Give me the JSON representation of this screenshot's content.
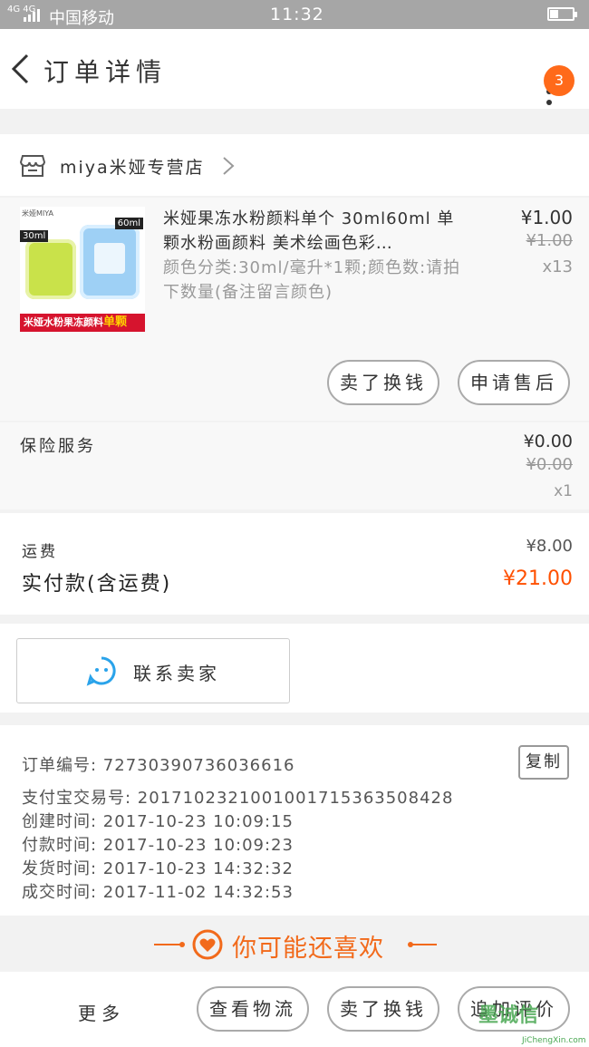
{
  "status_bar": {
    "network": "4G 4G",
    "carrier": "中国移动",
    "time": "11:32"
  },
  "header": {
    "title": "订单详情",
    "badge_count": "3"
  },
  "shop": {
    "name": "miya米娅专营店"
  },
  "product": {
    "title": "米娅果冻水粉颜料单个 30ml60ml 单颗水粉画颜料 美术绘画色彩…",
    "sku": "颜色分类:30ml/毫升*1颗;颜色数:请拍下数量(备注留言颜色)",
    "price": "¥1.00",
    "original_price": "¥1.00",
    "quantity": "x13",
    "thumb_brand": "米娅MIYA",
    "thumb_label_small": "30ml",
    "thumb_label_large": "60ml",
    "thumb_banner": "米娅水粉果冻颜料",
    "thumb_banner_tag": "单颗",
    "btn_return": "卖了换钱",
    "btn_aftersale": "申请售后"
  },
  "insurance": {
    "label": "保险服务",
    "price": "¥0.00",
    "original_price": "¥0.00",
    "quantity": "x1"
  },
  "freight": {
    "label": "运费",
    "value": "¥8.00",
    "total_label": "实付款(含运费)",
    "total_value": "¥21.00"
  },
  "contact": {
    "label": "联系卖家"
  },
  "order_info": {
    "copy_label": "复制",
    "lines": [
      "订单编号: 72730390736036616",
      "支付宝交易号: 2017102321001001715363508428",
      "创建时间: 2017-10-23 10:09:15",
      "付款时间: 2017-10-23 10:09:23",
      "发货时间: 2017-10-23 14:32:32",
      "成交时间: 2017-11-02 14:32:53"
    ]
  },
  "recommend": {
    "label": "你可能还喜欢"
  },
  "bottom_bar": {
    "more": "更多",
    "logistics": "查看物流",
    "sell": "卖了换钱",
    "review": "追加评价"
  },
  "watermark": {
    "text": "墨诚信",
    "sub": "JiChengXin.com"
  },
  "colors": {
    "accent": "#ff6a1a",
    "price_red": "#ff5000",
    "contact_blue": "#2aa3ea",
    "recommend_orange": "#f26a1b"
  }
}
